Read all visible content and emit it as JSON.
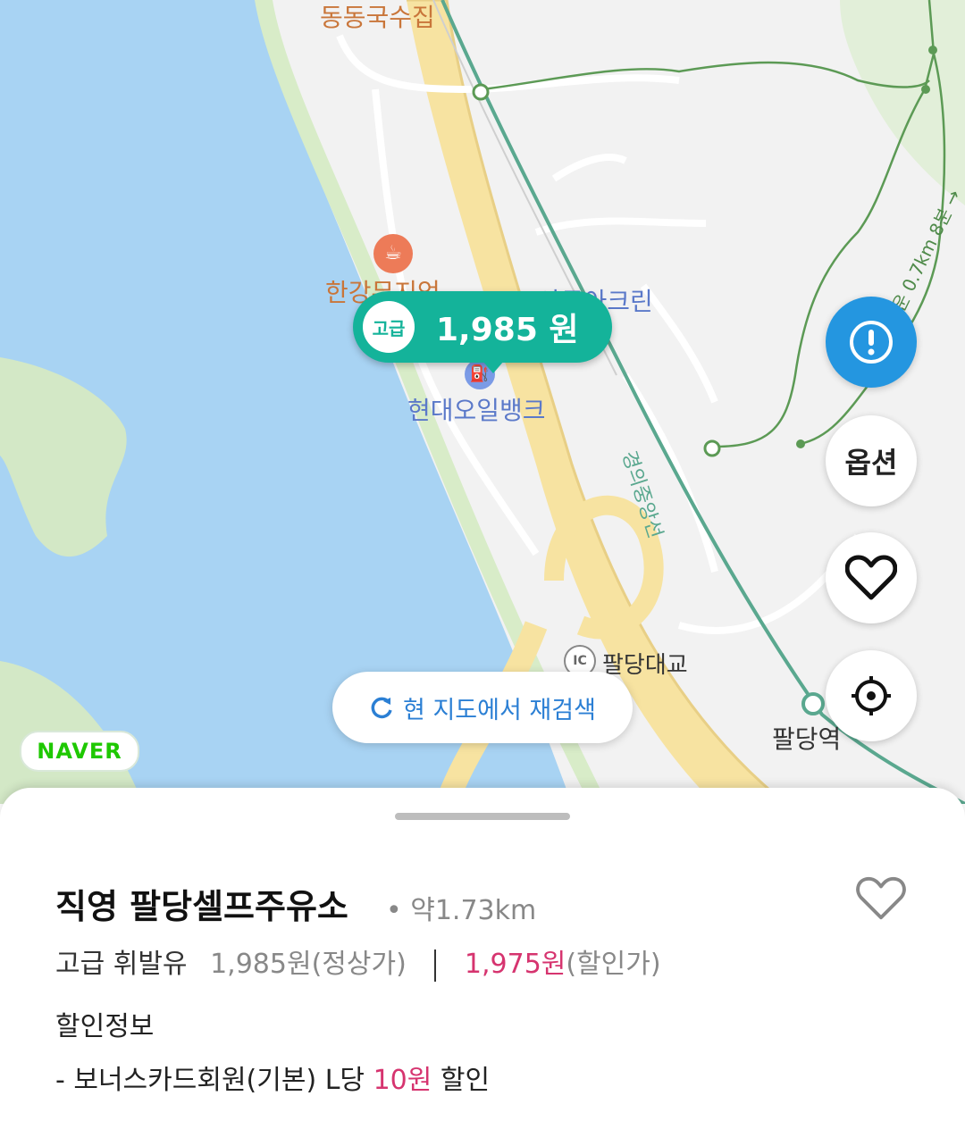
{
  "map": {
    "labels": {
      "restaurant": "동동국수집",
      "cafe": "한강뮤지엄",
      "place": "아쿠아크린",
      "station_name": "현대오일뱅크",
      "railway": "경의중앙선",
      "ic": "팔당대교",
      "subway_station": "팔당역",
      "trail": "운 0.7km 8분 →"
    },
    "ic_badge": "IC",
    "price_bubble": {
      "grade": "고급",
      "price": "1,985 원"
    },
    "research_button": "현 지도에서 재검색",
    "logo": "NAVER",
    "option_button": "옵션",
    "icons": [
      "alert-icon",
      "heart-icon",
      "locate-icon",
      "refresh-icon",
      "cafe-icon",
      "gas-pump-icon"
    ]
  },
  "sheet": {
    "station_name": "직영 팔당셀프주유소",
    "distance": "• 약1.73km",
    "fuel_type": "고급 휘발유",
    "regular_price": "1,985원",
    "regular_label": "(정상가)",
    "discount_price": "1,975원",
    "discount_label": "(할인가)",
    "discount_title": "할인정보",
    "discount_prefix": "- 보너스카드회원(기본) L당 ",
    "discount_amount": "10원",
    "discount_suffix": " 할인"
  },
  "colors": {
    "accent": "#14b39a",
    "discount": "#d6346f",
    "fab_alert": "#2496e0",
    "water": "#a8d3f3"
  }
}
